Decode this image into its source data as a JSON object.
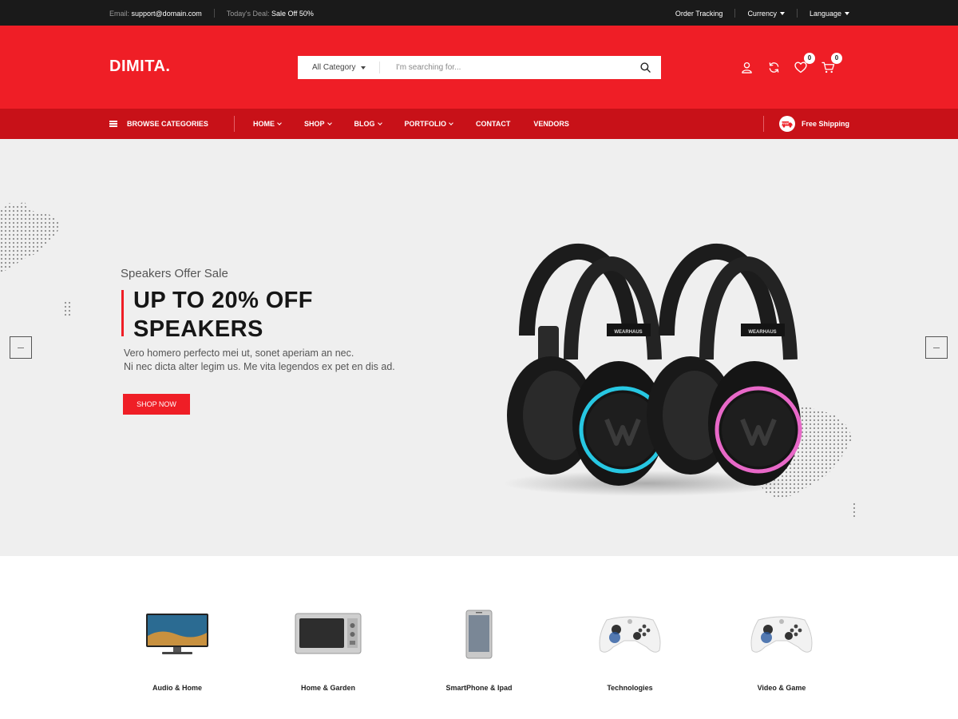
{
  "topbar": {
    "email_label": "Email:",
    "email_value": "support@domain.com",
    "deal_label": "Today's Deal:",
    "deal_value": "Sale Off 50%",
    "order_tracking": "Order Tracking",
    "currency": "Currency",
    "language": "Language"
  },
  "header": {
    "logo": "DIMITA.",
    "search_category": "All Category",
    "search_placeholder": "I'm searching for...",
    "wishlist_count": "0",
    "cart_count": "0",
    "icons": [
      "user-icon",
      "refresh-icon",
      "heart-icon",
      "cart-icon",
      "search-icon"
    ]
  },
  "nav": {
    "browse": "BROWSE CATEGORIES",
    "items": [
      {
        "label": "HOME",
        "dropdown": true
      },
      {
        "label": "SHOP",
        "dropdown": true
      },
      {
        "label": "BLOG",
        "dropdown": true
      },
      {
        "label": "PORTFOLIO",
        "dropdown": true
      },
      {
        "label": "CONTACT",
        "dropdown": false
      },
      {
        "label": "VENDORS",
        "dropdown": false
      }
    ],
    "free_shipping": "Free Shipping",
    "free_badge": "FREE"
  },
  "hero": {
    "subtitle": "Speakers Offer Sale",
    "headline_line1": "UP TO 20% OFF",
    "headline_line2": "SPEAKERS",
    "desc_line1": "Vero homero perfecto mei ut, sonet aperiam an nec.",
    "desc_line2": "Ni nec dicta alter legim us. Me vita legendos ex pet en dis ad.",
    "button": "SHOP NOW",
    "brand_text": "WEARHAUS"
  },
  "categories": [
    {
      "label": "Audio & Home"
    },
    {
      "label": "Home & Garden"
    },
    {
      "label": "SmartPhone & Ipad"
    },
    {
      "label": "Technologies"
    },
    {
      "label": "Video & Game"
    }
  ],
  "colors": {
    "brand_red": "#ef1e26",
    "nav_red": "#c81118",
    "topbar": "#1a1a1a",
    "hero_bg": "#efefef"
  }
}
